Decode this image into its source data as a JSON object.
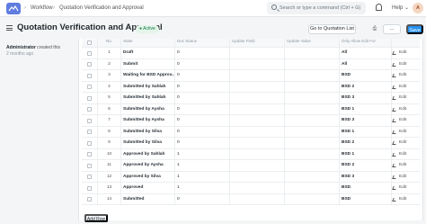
{
  "nav": {
    "breadcrumb_1": "Workflow",
    "breadcrumb_2": "Quotation Verification and Approval",
    "search_placeholder": "Search or type a command (Ctrl + G)",
    "help_label": "Help",
    "avatar_initial": "A"
  },
  "page": {
    "title": "Quotation Verification and Approval",
    "status_badge": "Active",
    "go_to_list_label": "Go to Quotation List",
    "more_label": "...",
    "save_label": "Save"
  },
  "sidebar": {
    "created_by": "Administrator",
    "created_text": "created this",
    "created_time": "2 months ago"
  },
  "table": {
    "headers": [
      "No.",
      "State",
      "Doc Status",
      "Update Field",
      "Update Value",
      "Only Allow Edit For"
    ],
    "edit_label": "Edit",
    "rows": [
      {
        "no": "1",
        "state": "Draft",
        "doc_status": "0",
        "allow": "All"
      },
      {
        "no": "2",
        "state": "Submit",
        "doc_status": "0",
        "allow": "All"
      },
      {
        "no": "3",
        "state": "Waiting for BSD Approv...",
        "doc_status": "0",
        "allow": "BSD"
      },
      {
        "no": "4",
        "state": "Submitted by Sahlah",
        "doc_status": "0",
        "allow": "BSD 2"
      },
      {
        "no": "5",
        "state": "Submitted by Sahlah",
        "doc_status": "0",
        "allow": "BSD 3"
      },
      {
        "no": "6",
        "state": "Submitted by Aysha",
        "doc_status": "0",
        "allow": "BSD 1"
      },
      {
        "no": "7",
        "state": "Submitted by Aysha",
        "doc_status": "0",
        "allow": "BSD 3"
      },
      {
        "no": "8",
        "state": "Submitted by Silva",
        "doc_status": "0",
        "allow": "BSD 1"
      },
      {
        "no": "9",
        "state": "Submitted by Silva",
        "doc_status": "0",
        "allow": "BSD 2"
      },
      {
        "no": "10",
        "state": "Approved by Sahlah",
        "doc_status": "1",
        "allow": "BSD 1"
      },
      {
        "no": "11",
        "state": "Approved by Aysha",
        "doc_status": "1",
        "allow": "BSD 2"
      },
      {
        "no": "12",
        "state": "Approved by Silva",
        "doc_status": "1",
        "allow": "BSD 3"
      },
      {
        "no": "13",
        "state": "Approved",
        "doc_status": "1",
        "allow": "BSD"
      },
      {
        "no": "14",
        "state": "Submitted",
        "doc_status": "0",
        "allow": "BSD"
      }
    ],
    "add_row_label": "Add Row"
  }
}
